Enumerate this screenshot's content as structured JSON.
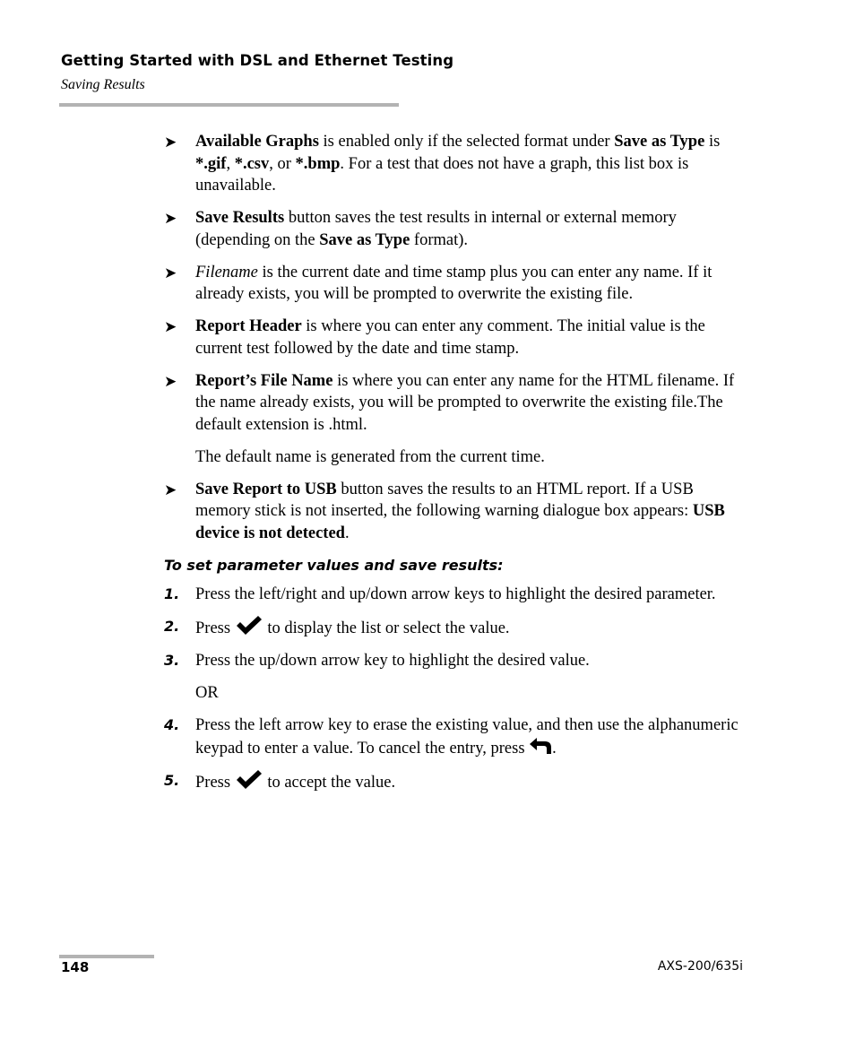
{
  "header": {
    "title": "Getting Started with DSL and Ethernet Testing",
    "subtitle": "Saving Results"
  },
  "bullets": [
    {
      "parts": [
        {
          "t": "Available Graphs",
          "b": true
        },
        {
          "t": " is enabled only if the selected format under "
        },
        {
          "t": "Save as Type",
          "b": true
        },
        {
          "t": " is "
        },
        {
          "t": "*.gif",
          "b": true
        },
        {
          "t": ", "
        },
        {
          "t": "*.csv",
          "b": true
        },
        {
          "t": ", or "
        },
        {
          "t": "*.bmp",
          "b": true
        },
        {
          "t": ". For a test that does not have a graph, this list box is unavailable."
        }
      ]
    },
    {
      "parts": [
        {
          "t": "Save Results",
          "b": true
        },
        {
          "t": " button saves the test results in internal or external memory (depending on the "
        },
        {
          "t": "Save as Type",
          "b": true
        },
        {
          "t": " format)."
        }
      ]
    },
    {
      "parts": [
        {
          "t": "Filename",
          "i": true
        },
        {
          "t": " is the current date and time stamp plus you can enter any name. If it already exists, you will be prompted to overwrite the existing file."
        }
      ]
    },
    {
      "parts": [
        {
          "t": "Report Header",
          "b": true
        },
        {
          "t": " is where you can enter any comment. The initial value is the current test followed by the date and time stamp."
        }
      ]
    },
    {
      "parts": [
        {
          "t": "Report’s File Name",
          "b": true
        },
        {
          "t": " is where you can enter any name for the HTML filename. If the name already exists, you will be prompted to overwrite the existing file.The default extension is .html."
        }
      ],
      "note": "The default name is generated from the current time."
    },
    {
      "parts": [
        {
          "t": "Save Report to USB",
          "b": true
        },
        {
          "t": " button saves the results to an HTML report. If a USB memory stick is not inserted, the following warning dialogue box appears: "
        },
        {
          "t": "USB device is not detected",
          "b": true
        },
        {
          "t": "."
        }
      ]
    }
  ],
  "bullet_glyph": "➤",
  "procedure": {
    "title": "To set parameter values and save results:",
    "steps": [
      {
        "num": "1.",
        "before": "Press the left/right and up/down arrow keys to highlight the desired parameter."
      },
      {
        "num": "2.",
        "before": "Press ",
        "icon": "checkmark-icon",
        "after": " to display the list or select the value."
      },
      {
        "num": "3.",
        "before": "Press the up/down arrow key to highlight the desired value.",
        "extra": "OR"
      },
      {
        "num": "4.",
        "before": "Press the left arrow key to erase the existing value, and then use the alphanumeric keypad to enter a value. To cancel the entry, press ",
        "icon": "return-arrow-icon",
        "after": "."
      },
      {
        "num": "5.",
        "before": "Press ",
        "icon": "checkmark-icon",
        "after": " to accept the value."
      }
    ]
  },
  "footer": {
    "page_number": "148",
    "model": "AXS-200/635i"
  }
}
